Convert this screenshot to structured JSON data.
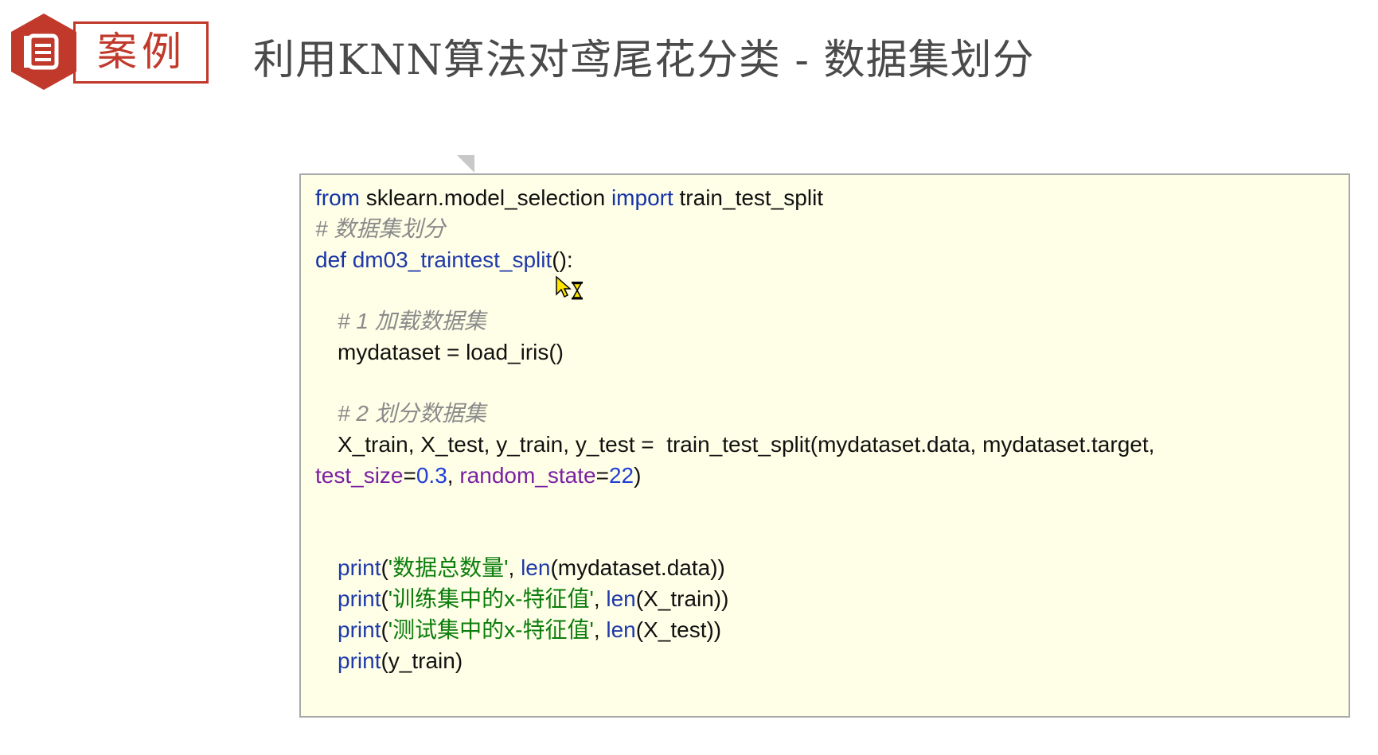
{
  "header": {
    "badge_label": "案例",
    "title": "利用KNN算法对鸢尾花分类 - 数据集划分",
    "badge_icon": "document-icon",
    "badge_color": "#c0392b"
  },
  "code": {
    "line1": {
      "kw1": "from",
      "mod": " sklearn.model_selection ",
      "kw2": "import",
      "name": " train_test_split"
    },
    "line2": {
      "comment": "# 数据集划分"
    },
    "line3": {
      "def": "def ",
      "fname": "dm03_traintest_split",
      "rest": "():"
    },
    "line4": {
      "comment": "# 1 加载数据集"
    },
    "line5": {
      "text": "mydataset = load_iris()"
    },
    "line6": {
      "comment": "# 2 划分数据集"
    },
    "line7": {
      "text": "X_train, X_test, y_train, y_test =  train_test_split(mydataset.data, mydataset.target,"
    },
    "line8": {
      "p1": "test_size",
      "eq1": "=",
      "v1": "0.3",
      "sep": ", ",
      "p2": "random_state",
      "eq2": "=",
      "v2": "22",
      "close": ")"
    },
    "line9": {
      "fn": "print",
      "open": "(",
      "str": "'数据总数量'",
      "sep": ", ",
      "fn2": "len",
      "rest": "(mydataset.data))"
    },
    "line10": {
      "fn": "print",
      "open": "(",
      "str": "'训练集中的x-特征值'",
      "sep": ", ",
      "fn2": "len",
      "rest": "(X_train))"
    },
    "line11": {
      "fn": "print",
      "open": "(",
      "str": "'测试集中的x-特征值'",
      "sep": ", ",
      "fn2": "len",
      "rest": "(X_test))"
    },
    "line12": {
      "fn": "print",
      "rest": "(y_train)"
    }
  },
  "colors": {
    "keyword": "#1533a6",
    "comment": "#8a8a8a",
    "string": "#0b7d0b",
    "param": "#7a1fa2",
    "number": "#1f3fd6",
    "panel_bg": "#ffffe8"
  },
  "cursor": {
    "icon": "busy-cursor-icon"
  }
}
